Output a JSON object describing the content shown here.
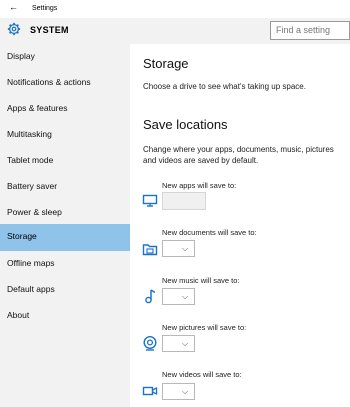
{
  "window": {
    "title": "Settings",
    "back_glyph": "←"
  },
  "header": {
    "section": "SYSTEM",
    "icon": "gear-icon"
  },
  "search": {
    "placeholder": "Find a setting"
  },
  "sidebar": {
    "items": [
      {
        "label": "Display",
        "selected": false
      },
      {
        "label": "Notifications & actions",
        "selected": false
      },
      {
        "label": "Apps & features",
        "selected": false
      },
      {
        "label": "Multitasking",
        "selected": false
      },
      {
        "label": "Tablet mode",
        "selected": false
      },
      {
        "label": "Battery saver",
        "selected": false
      },
      {
        "label": "Power & sleep",
        "selected": false
      },
      {
        "label": "Storage",
        "selected": true
      },
      {
        "label": "Offline maps",
        "selected": false
      },
      {
        "label": "Default apps",
        "selected": false
      },
      {
        "label": "About",
        "selected": false
      }
    ]
  },
  "main": {
    "title": "Storage",
    "subtitle": "Choose a drive to see what's taking up space.",
    "save_title": "Save locations",
    "save_desc": "Change where your apps, documents, music, pictures and videos are saved by default.",
    "locations": [
      {
        "label": "New apps will save to:",
        "icon": "monitor-icon",
        "value": ""
      },
      {
        "label": "New documents will save to:",
        "icon": "folder-icon",
        "value": ""
      },
      {
        "label": "New music will save to:",
        "icon": "music-note-icon",
        "value": ""
      },
      {
        "label": "New pictures will save to:",
        "icon": "camera-icon",
        "value": ""
      },
      {
        "label": "New videos will save to:",
        "icon": "video-camera-icon",
        "value": ""
      }
    ],
    "chevron_glyph": "⌵"
  },
  "colors": {
    "accent": "#8fc3ea",
    "sidebar_bg": "#f2f2f2",
    "icon_blue": "#1a73c8"
  }
}
